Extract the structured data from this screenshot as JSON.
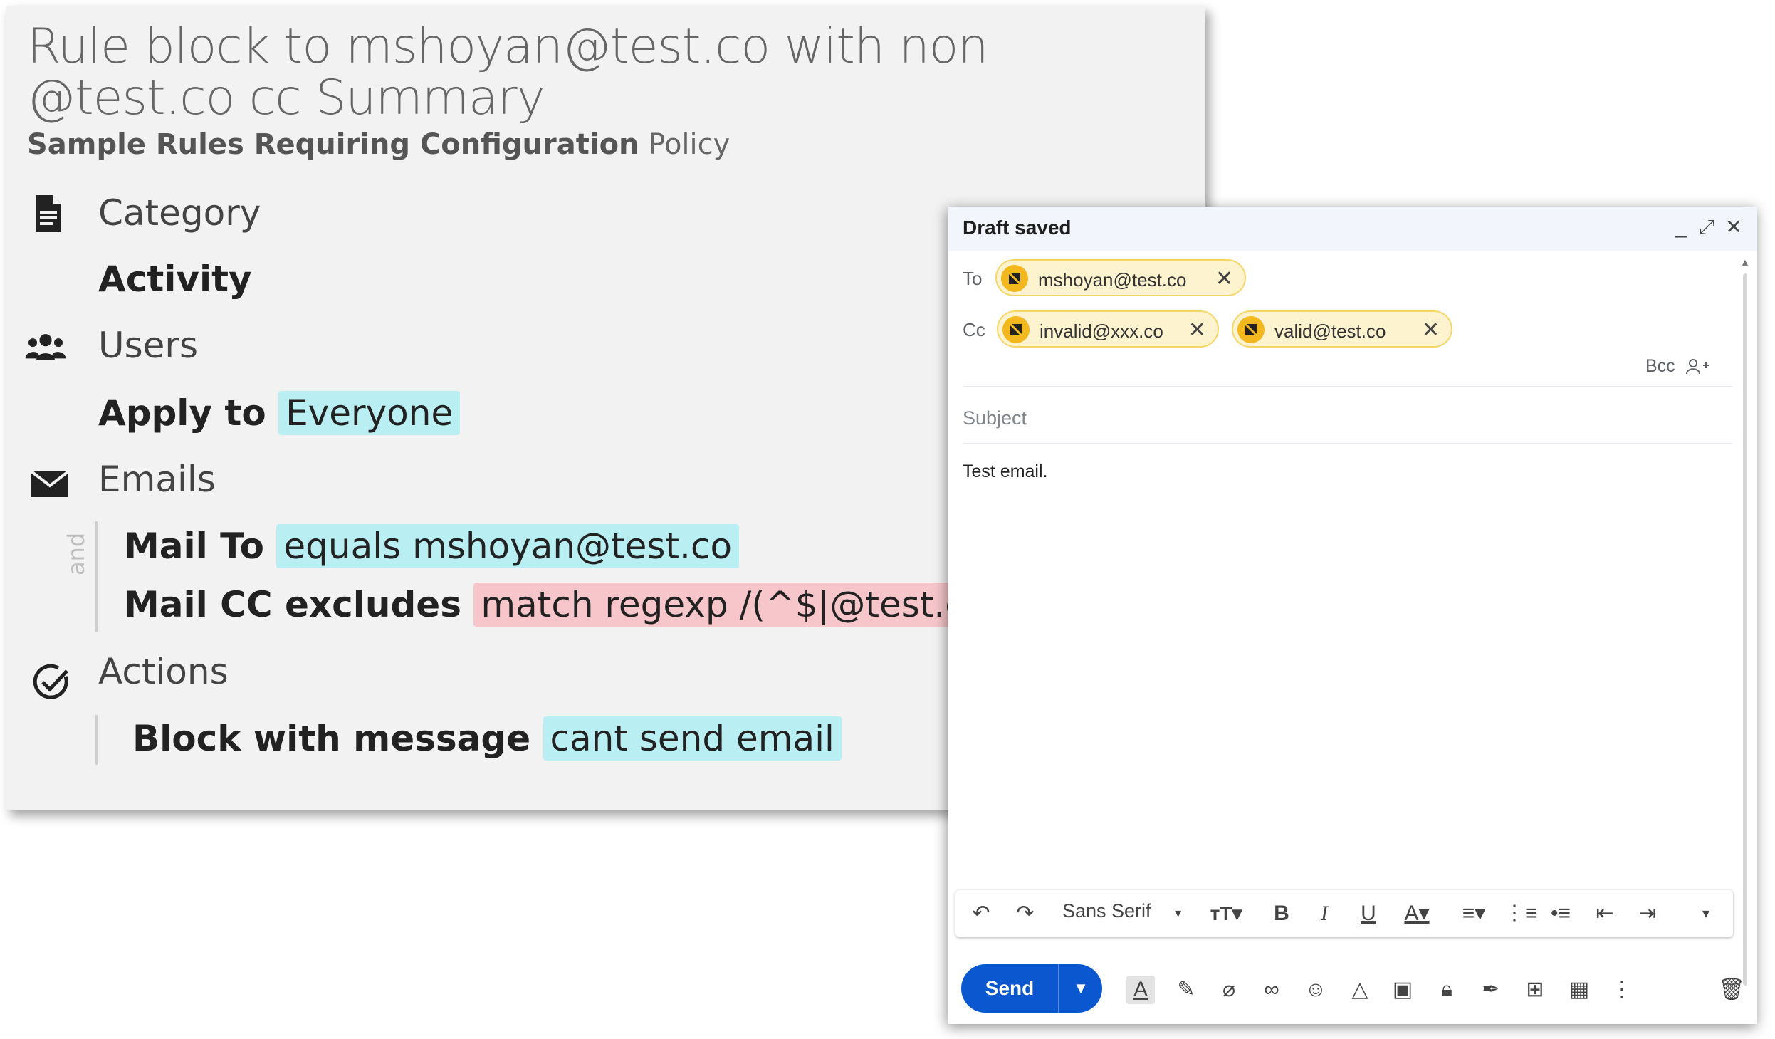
{
  "rule": {
    "title": "Rule block to mshoyan@test.co with non @test.co cc Summary",
    "subtitle_bold": "Sample Rules Requiring Configuration",
    "subtitle_rest": " Policy",
    "category": {
      "label": "Category",
      "value": "Activity"
    },
    "users": {
      "label": "Users",
      "apply_prefix": "Apply to",
      "apply_value": "Everyone"
    },
    "emails": {
      "label": "Emails",
      "connector": "and",
      "conditions": [
        {
          "prefix": "Mail To",
          "value": "equals mshoyan@test.co",
          "color": "#b9eef2"
        },
        {
          "prefix": "Mail CC excludes",
          "value": "match regexp /(^$|@test.co)/",
          "color": "#f6c6ca"
        }
      ]
    },
    "actions": {
      "label": "Actions",
      "prefix": "Block with message",
      "value": "cant send email"
    },
    "icons": [
      "document-icon",
      "users-icon",
      "envelope-icon",
      "check-circle-icon"
    ]
  },
  "compose": {
    "title": "Draft saved",
    "to_label": "To",
    "cc_label": "Cc",
    "to": [
      "mshoyan@test.co"
    ],
    "cc": [
      "invalid@xxx.co",
      "valid@test.co"
    ],
    "bcc_label": "Bcc",
    "subject_placeholder": "Subject",
    "body": "Test email.",
    "font_name": "Sans Serif",
    "send_label": "Send",
    "chip_warning_color": "#f2b81e",
    "send_color": "#0b57d0"
  }
}
